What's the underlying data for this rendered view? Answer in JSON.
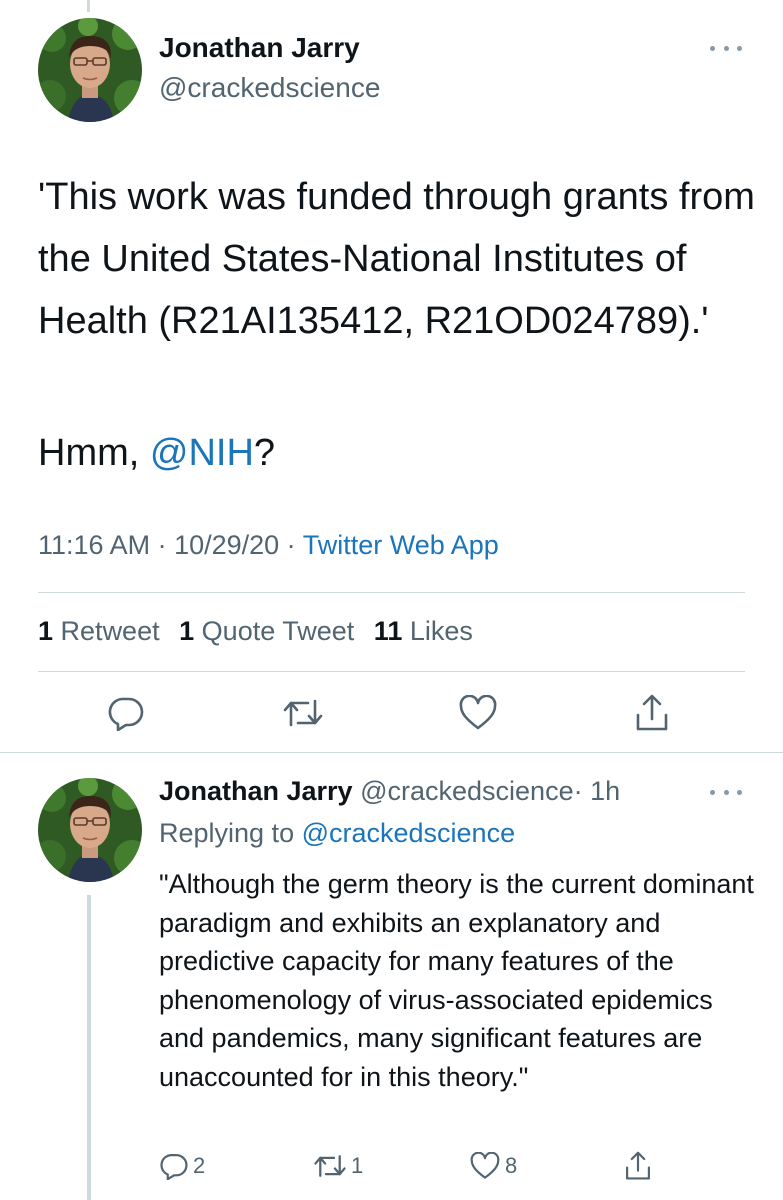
{
  "main_tweet": {
    "author_name": "Jonathan Jarry",
    "author_handle": "@crackedscience",
    "text_quote": "'This work was funded through grants from the United States-National Institutes of Health (R21AI135412, R21OD024789).'",
    "text_line2_prefix": "Hmm, ",
    "text_line2_mention": "@NIH",
    "text_line2_suffix": "?",
    "timestamp": "11:16 AM · 10/29/20 · ",
    "source_app": "Twitter Web App",
    "stats": {
      "retweets_count": "1",
      "retweets_label": "Retweet",
      "quotes_count": "1",
      "quotes_label": "Quote Tweet",
      "likes_count": "11",
      "likes_label": "Likes"
    },
    "actions": [
      "reply-icon",
      "retweet-icon",
      "like-icon",
      "share-icon"
    ]
  },
  "reply_tweet": {
    "author_name": "Jonathan Jarry",
    "author_handle": "@crackedscience",
    "time_ago": "· 1h",
    "replying_to_label": "Replying to ",
    "replying_to_handle": "@crackedscience",
    "text": "\"Although the germ theory is the current dominant paradigm and exhibits an explanatory and predictive capacity for many features of the phenomenology of virus-associated epidemics and pandemics, many significant features are unaccounted for in this theory.\"",
    "reply_count": "2",
    "retweet_count": "1",
    "like_count": "8"
  },
  "colors": {
    "text_primary": "#0f1419",
    "text_secondary": "#536471",
    "link": "#1b75bb",
    "divider": "#cfd9de"
  }
}
